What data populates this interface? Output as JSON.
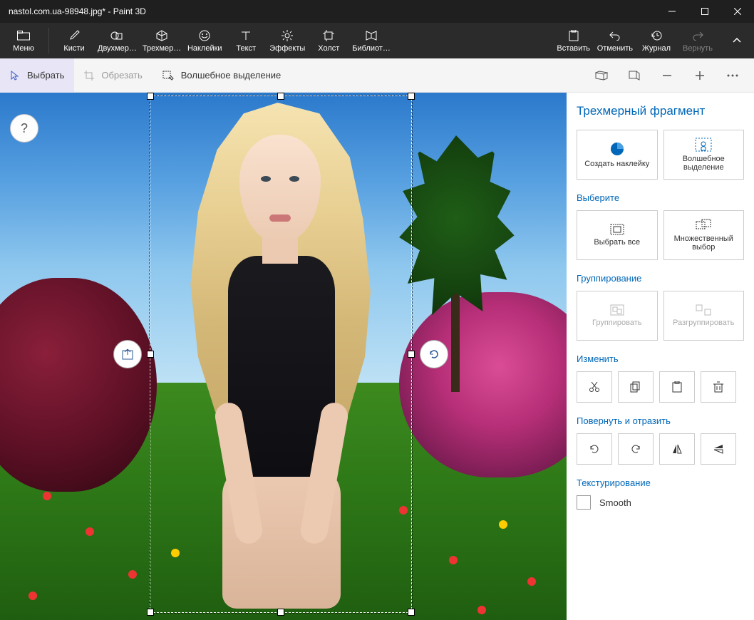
{
  "titlebar": {
    "title": "nastol.com.ua-98948.jpg* - Paint 3D"
  },
  "ribbon": {
    "menu": "Меню",
    "brushes": "Кисти",
    "shapes2d": "Двухмер…",
    "shapes3d": "Трехмер…",
    "stickers": "Наклейки",
    "text": "Текст",
    "effects": "Эффекты",
    "canvas": "Холст",
    "library": "Библиот…",
    "paste": "Вставить",
    "undo": "Отменить",
    "history": "Журнал",
    "redo": "Вернуть"
  },
  "toolbar": {
    "select": "Выбрать",
    "crop": "Обрезать",
    "magic": "Волшебное выделение"
  },
  "panel": {
    "title": "Трехмерный фрагмент",
    "make_sticker": "Создать наклейку",
    "magic_select": "Волшебное выделение",
    "choose": "Выберите",
    "select_all": "Выбрать все",
    "multi_select": "Множественный выбор",
    "grouping": "Группирование",
    "group": "Группировать",
    "ungroup": "Разгруппировать",
    "edit": "Изменить",
    "rotate_flip": "Повернуть и отразить",
    "texturing": "Текстурирование",
    "smooth": "Smooth"
  }
}
